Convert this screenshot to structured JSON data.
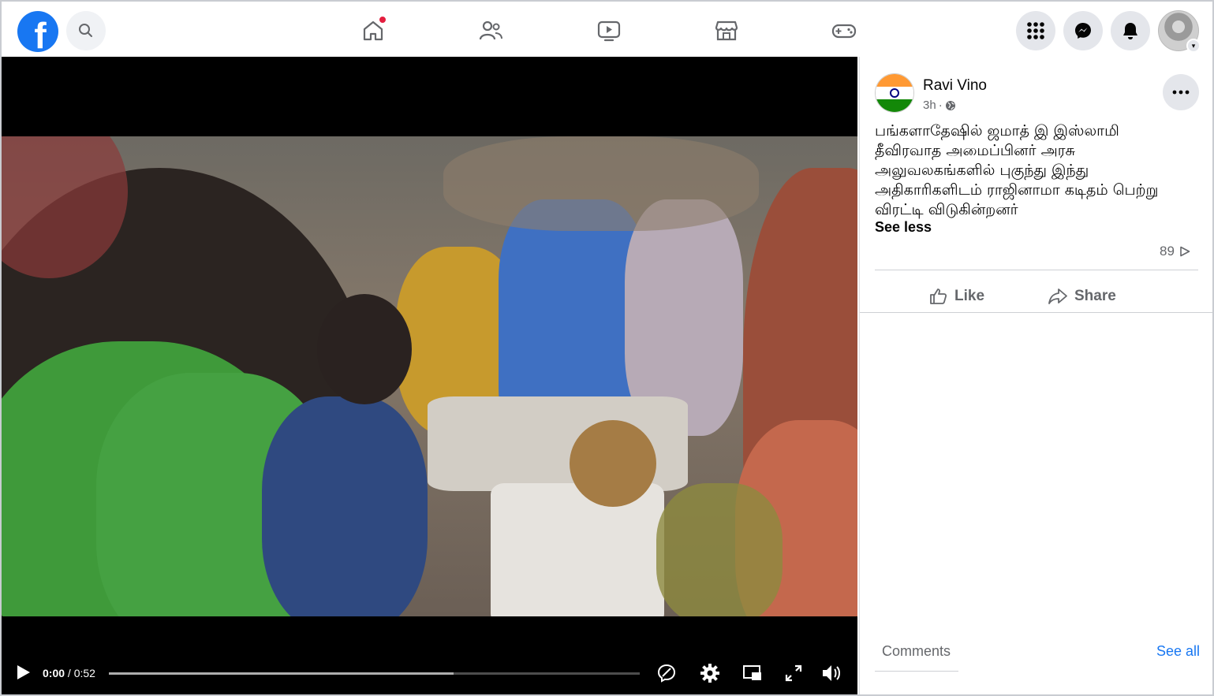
{
  "nav": {
    "logo": "f",
    "icons": [
      "search-icon",
      "home-icon",
      "friends-icon",
      "watch-icon",
      "marketplace-icon",
      "gaming-icon",
      "menu-grid-icon",
      "messenger-icon",
      "notifications-icon"
    ],
    "home_has_notification": true
  },
  "video": {
    "current_time": "0:00",
    "duration": "0:52",
    "time_separator": " / ",
    "buffered_fraction": 0.65,
    "controls": [
      "play-icon",
      "captions-icon",
      "settings-icon",
      "miniplayer-icon",
      "fullscreen-icon",
      "volume-icon"
    ]
  },
  "post": {
    "author": "Ravi Vino",
    "time": "3h",
    "time_dot": "·",
    "privacy": "globe-icon",
    "text": "பங்களாதேஷில் ஜமாத் இ இஸ்லாமி தீவிரவாத அமைப்பினர் அரசு அலுவலகங்களில் புகுந்து இந்து அதிகாரிகளிடம் ராஜினாமா கடிதம் பெற்று விரட்டி விடுகின்றனர்",
    "see_less": "See less",
    "views": "89",
    "actions": {
      "like": "Like",
      "share": "Share"
    }
  },
  "comments": {
    "label": "Comments",
    "see_all": "See all"
  },
  "colors": {
    "brand": "#1877f2",
    "notification": "#e41e3f",
    "text_secondary": "#65676b"
  }
}
